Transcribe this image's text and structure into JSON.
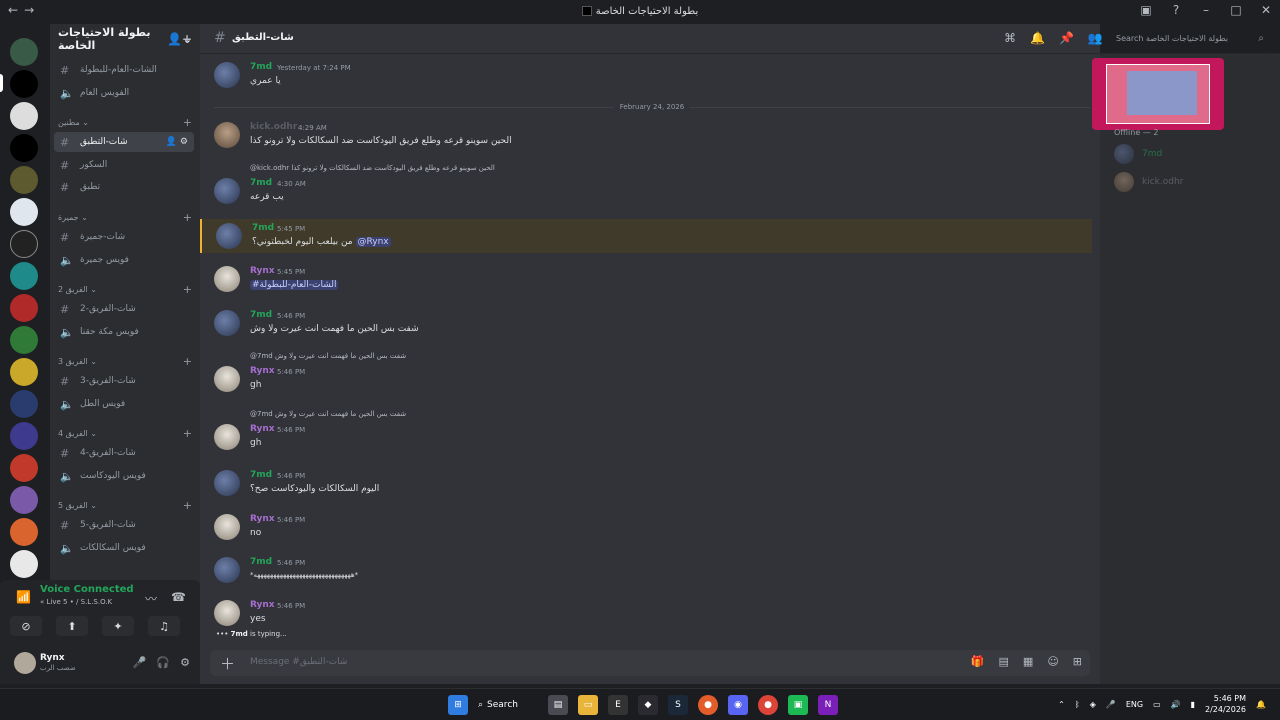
{
  "window": {
    "title": "بطولة الاحتياجات الخاصة",
    "back_icon": "arrow-left-icon",
    "forward_icon": "arrow-right-icon"
  },
  "guild": {
    "name": "بطولة الاحتياجات الخاصة"
  },
  "channels": [
    {
      "type": "text",
      "label": "الشات-العام-للبطولة"
    },
    {
      "type": "voice",
      "label": "الفويس العام"
    },
    {
      "type": "category",
      "label": "مطنين"
    },
    {
      "type": "text",
      "label": "شات-التطبق",
      "active": true
    },
    {
      "type": "text",
      "label": "السكور"
    },
    {
      "type": "text",
      "label": "تطبق"
    },
    {
      "type": "category",
      "label": "جميرة"
    },
    {
      "type": "text",
      "label": "شات-جميرة"
    },
    {
      "type": "voice",
      "label": "فويس جميرة"
    },
    {
      "type": "category",
      "label": "الفريق 2"
    },
    {
      "type": "text",
      "label": "شات-الفريق-2"
    },
    {
      "type": "voice",
      "label": "فويس مكة حقنا"
    },
    {
      "type": "category",
      "label": "الفريق 3"
    },
    {
      "type": "text",
      "label": "شات-الفريق-3"
    },
    {
      "type": "voice",
      "label": "فويس الطل"
    },
    {
      "type": "category",
      "label": "الفريق 4"
    },
    {
      "type": "text",
      "label": "شات-الفريق-4"
    },
    {
      "type": "voice",
      "label": "فويس اليودكاست"
    },
    {
      "type": "category",
      "label": "الفريق 5"
    },
    {
      "type": "text",
      "label": "شات-الفريق-5"
    },
    {
      "type": "voice",
      "label": "فويس السكالكات"
    }
  ],
  "voice": {
    "status": "Voice Connected",
    "sub": "« Live 5 • / S.L.S.O.K"
  },
  "user": {
    "name": "Rynx",
    "status": "ضصب الرب"
  },
  "chat": {
    "channel_name": "شات-التطبق",
    "search_placeholder": "Search بطولة الاحتياجات الخاصة",
    "composer_placeholder": "Message #شات-التطبق",
    "date_divider": "February 24, 2026",
    "typing": "7md",
    "typing_suffix": " is typing..."
  },
  "messages": [
    {
      "author": "7md",
      "time": "Yesterday at 7:24 PM",
      "text": "يا عمري"
    },
    {
      "author": "kick.odhr",
      "time": "4:29 AM",
      "text": "الحين سوينو قرعه وطلع فريق اليودكاست ضد السكالكات ولا ترونو كذا"
    },
    {
      "reply": "@kick.odhr الحين سوينو قرعه وطلع فريق اليودكاست ضد السكالكات ولا ترونو كذا",
      "author": "7md",
      "time": "4:30 AM",
      "text": "يب قرعه"
    },
    {
      "author": "7md",
      "time": "5:45 PM",
      "text": "من بيلعب اليوم لخبطتوني؟",
      "mention": "@Rynx"
    },
    {
      "author": "Rynx",
      "time": "5:45 PM",
      "text": "#الشات-العام-للبطولة"
    },
    {
      "author": "7md",
      "time": "5:46 PM",
      "text": "شفت بس الحين ما فهمت انت عيرت ولا وش"
    },
    {
      "reply": "@7md شفت بس الحين ما فهمت انت عيرت ولا وش",
      "author": "Rynx",
      "time": "5:46 PM",
      "text": "gh"
    },
    {
      "reply": "@7md شفت بس الحين ما فهمت انت عيرت ولا وش",
      "author": "Rynx",
      "time": "5:46 PM",
      "text": "gh"
    },
    {
      "author": "7md",
      "time": "5:46 PM",
      "text": "اليوم السكالكات واليودكاست صح؟"
    },
    {
      "author": "Rynx",
      "time": "5:46 PM",
      "text": "no"
    },
    {
      "author": "7md",
      "time": "5:46 PM",
      "text": "*ههههههههههههههههههههههههههههههه*"
    },
    {
      "author": "Rynx",
      "time": "5:46 PM",
      "text": "yes"
    }
  ],
  "members": {
    "offline_header": "Offline — 2",
    "list": [
      {
        "name": "7md"
      },
      {
        "name": "kick.odhr"
      }
    ]
  },
  "taskbar": {
    "search_label": "Search",
    "lang": "ENG",
    "time": "5:46 PM",
    "date": "2/24/2026"
  }
}
